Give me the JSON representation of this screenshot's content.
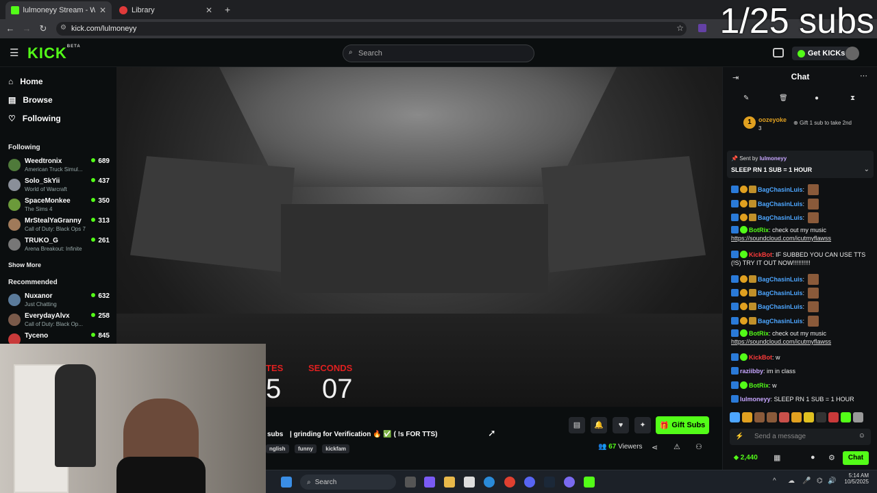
{
  "browser": {
    "tabs": [
      {
        "title": "lulmoneyy Stream - Watch Live",
        "active": true
      },
      {
        "title": "Library",
        "active": false
      }
    ],
    "url": "kick.com/lulmoneyy"
  },
  "overlay": {
    "sub_goal": "1/25 subs"
  },
  "header": {
    "logo": "KICK",
    "logo_beta": "BETA",
    "search_placeholder": "Search",
    "get_kicks": "Get KICKs"
  },
  "sidebar": {
    "nav": [
      {
        "label": "Home",
        "icon": "home-icon"
      },
      {
        "label": "Browse",
        "icon": "browse-icon"
      },
      {
        "label": "Following",
        "icon": "heart-icon"
      }
    ],
    "following_title": "Following",
    "following": [
      {
        "name": "Weedtronix",
        "game": "American Truck Simul...",
        "viewers": "689",
        "color": "#4f7a3a"
      },
      {
        "name": "Solo_SkYii",
        "game": "World of Warcraft",
        "viewers": "437",
        "color": "#8a8f99"
      },
      {
        "name": "SpaceMonkee",
        "game": "The Sims 4",
        "viewers": "350",
        "color": "#6b9a3a"
      },
      {
        "name": "MrStealYaGranny",
        "game": "Call of Duty: Black Ops 7",
        "viewers": "313",
        "color": "#a07a5a"
      },
      {
        "name": "TRUKO_G",
        "game": "Arena Breakout: Infinite",
        "viewers": "261",
        "color": "#777777"
      }
    ],
    "show_more": "Show More",
    "recommended_title": "Recommended",
    "recommended": [
      {
        "name": "Nuxanor",
        "game": "Just Chatting",
        "viewers": "632",
        "color": "#5a7a9a"
      },
      {
        "name": "EverydayAlvx",
        "game": "Call of Duty: Black Op...",
        "viewers": "258",
        "color": "#7a5a4a"
      },
      {
        "name": "Tyceno",
        "game": "",
        "viewers": "845",
        "color": "#c93a3a"
      }
    ]
  },
  "video": {
    "timer_left_label": "TES",
    "timer_left_value": "5",
    "timer_right_label": "SECONDS",
    "timer_right_value": "07"
  },
  "stream": {
    "title_prefix": "subs",
    "title": "| grinding for Verification 🔥 ✅ ( !s FOR TTS)",
    "tags": [
      "nglish",
      "funny",
      "kickfam"
    ],
    "viewers": "67",
    "viewers_label": "Viewers",
    "gift_subs": "Gift Subs"
  },
  "chat": {
    "title": "Chat",
    "top_gifter": {
      "rank": "1",
      "name": "oozeyoke",
      "count": "3",
      "cta": "Gift 1 sub to take 2nd"
    },
    "pinned": {
      "sent_by_label": "Sent by",
      "sender": "lulmoneyy",
      "message": "SLEEP RN 1 SUB = 1 HOUR"
    },
    "messages": [
      {
        "user": "BagChasinLuis",
        "text": "",
        "cls": "u-bag",
        "face": true
      },
      {
        "user": "BagChasinLuis",
        "text": "",
        "cls": "u-bag",
        "face": true
      },
      {
        "user": "BagChasinLuis",
        "text": "",
        "cls": "u-bag",
        "face": true
      },
      {
        "user": "BotRix",
        "text": "check out my music",
        "link": "https://soundcloud.com/icutmyflawss",
        "cls": "u-bot"
      },
      {
        "user": "KickBot",
        "text": "IF SUBBED YOU CAN USE TTS (!S) TRY IT OUT NOW!!!!!!!!!!",
        "cls": "u-kb"
      },
      {
        "user": "BagChasinLuis",
        "text": "",
        "cls": "u-bag",
        "face": true
      },
      {
        "user": "BagChasinLuis",
        "text": "",
        "cls": "u-bag",
        "face": true
      },
      {
        "user": "BagChasinLuis",
        "text": "",
        "cls": "u-bag",
        "face": true
      },
      {
        "user": "BagChasinLuis",
        "text": "",
        "cls": "u-bag",
        "face": true
      },
      {
        "user": "BotRix",
        "text": "check out my music",
        "link": "https://soundcloud.com/icutmyflawss",
        "cls": "u-bot"
      },
      {
        "user": "KickBot",
        "text": "w",
        "cls": "u-kb"
      },
      {
        "user": "raziibby",
        "text": "im in class",
        "cls": "u-raz"
      },
      {
        "user": "BotRix",
        "text": "w",
        "cls": "u-bot"
      },
      {
        "user": "lulmoneyy",
        "text": "SLEEP RN 1 SUB = 1 HOUR",
        "cls": "u-lul"
      }
    ],
    "input_placeholder": "Send a message",
    "points": "2,440",
    "send_label": "Chat"
  },
  "taskbar": {
    "search": "Search",
    "time": "5:14 AM",
    "date": "10/5/2025"
  },
  "colors": {
    "accent": "#53fc18",
    "bg": "#0b0e0f",
    "chat_bg": "#0f1113"
  }
}
